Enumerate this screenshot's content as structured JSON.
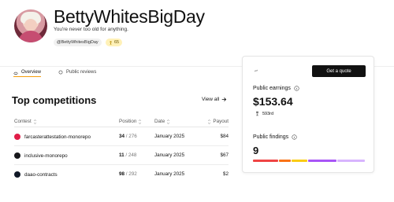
{
  "profile": {
    "name": "BettyWhitesBigDay",
    "tagline": "You're never too old for anything.",
    "handle": "@BettyWhitesBigDay",
    "rank": "65"
  },
  "tabs": [
    {
      "label": "Overview",
      "active": true
    },
    {
      "label": "Public reviews",
      "active": false
    }
  ],
  "competitions": {
    "title": "Top competitions",
    "view_all": "View all",
    "columns": [
      "Contest",
      "Position",
      "Date",
      "Payout"
    ],
    "rows": [
      {
        "contest": "farcasterattestation-monorepo",
        "position_rank": "34",
        "position_total": "/ 276",
        "date": "January 2025",
        "payout": "$84",
        "logo_color": "#e11d48"
      },
      {
        "contest": "inclusive-monorepo",
        "position_rank": "11",
        "position_total": "/ 248",
        "date": "January 2025",
        "payout": "$67",
        "logo_color": "#18181b"
      },
      {
        "contest": "daao-contracts",
        "position_rank": "98",
        "position_total": "/ 292",
        "date": "January 2025",
        "payout": "$2",
        "logo_color": "#111827"
      }
    ]
  },
  "sidebar": {
    "quote_button": "Get a quote",
    "earnings_label": "Public earnings",
    "earnings_value": "$153.64",
    "earnings_rank": "593rd",
    "findings_label": "Public findings",
    "findings_value": "9",
    "severity_colors": [
      "#ef4444",
      "#f97316",
      "#facc15",
      "#a855f7",
      "#d8b4fe"
    ]
  }
}
